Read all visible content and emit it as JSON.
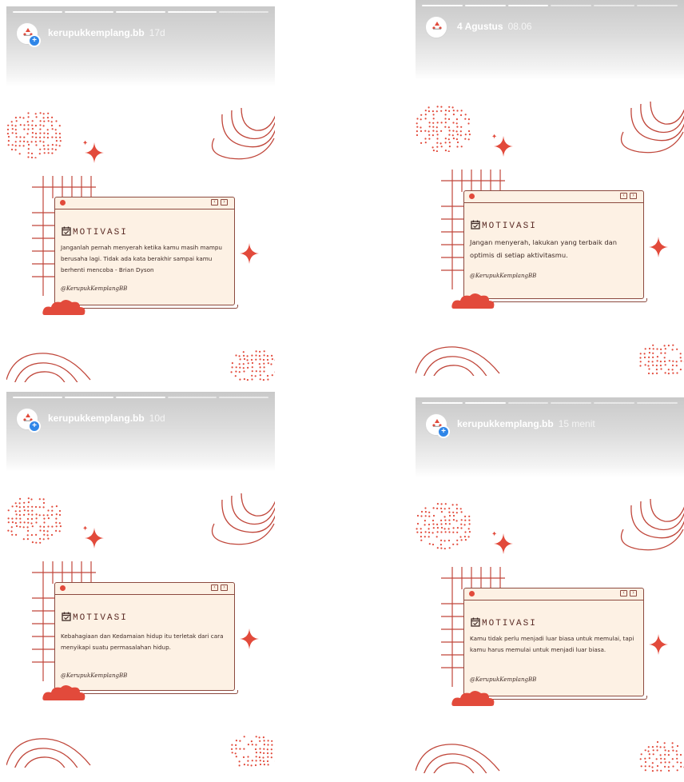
{
  "stories": [
    {
      "username": "kerupukkemplang.bb",
      "time": "17d",
      "card": {
        "title": "MOTIVASI",
        "quote": "Janganlah pernah menyerah ketika kamu masih mampu berusaha lagi. Tidak ada kata berakhir sampai kamu berhenti mencoba - Brian Dyson",
        "handle": "@KerupukKemplangBB"
      }
    },
    {
      "username": "",
      "time_primary": "4 Agustus",
      "time": "08.06",
      "card": {
        "title": "MOTIVASI",
        "quote": "Jangan menyerah, lakukan yang terbaik dan optimis di setiap aktivitasmu.",
        "handle": "@KerupukKemplangBB"
      }
    },
    {
      "username": "kerupukkemplang.bb",
      "time": "10d",
      "card": {
        "title": "MOTIVASI",
        "quote": "Kebahagiaan dan Kedamaian hidup itu terletak dari cara menyikapi suatu permasalahan hidup.",
        "handle": "@KerupukKemplangBB"
      }
    },
    {
      "username": "kerupukkemplang.bb",
      "time": "15 menit",
      "card": {
        "title": "MOTIVASI",
        "quote": "Kamu tidak perlu menjadi luar biasa untuk memulai, tapi kamu harus memulai untuk menjadi luar biasa.",
        "handle": "@KerupukKemplangBB"
      }
    }
  ],
  "colors": {
    "accent_red": "#e24a3b",
    "line_brown": "#8c4a3f",
    "card_bg": "#fdf1e4",
    "verified_blue": "#2f86e8"
  },
  "icons": [
    "avatar-logo-icon",
    "add-story-plus-icon",
    "calendar-check-icon",
    "sparkle-icon",
    "window-prev-icon",
    "window-next-icon"
  ]
}
